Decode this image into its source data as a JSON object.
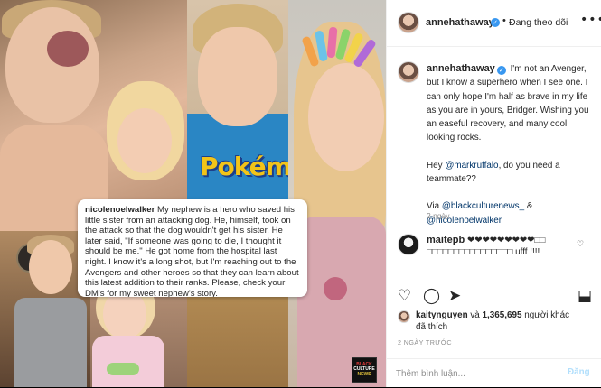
{
  "image": {
    "text_overlay": "Pokémon",
    "logo_text": [
      "BLACK",
      "CULTURE",
      "NEWS"
    ],
    "repost_caption": {
      "username": "nicolenoelwalker",
      "text": "My nephew is a hero who saved his little sister from an attacking dog.  He, himself, took on the attack so that the dog wouldn't get his sister.  He later said, \"If someone was going to die, I thought it should be me.\" He got home from the hospital last night.  I know it's a long shot, but I'm reaching out to the Avengers and other heroes so that they can learn about this latest addition to their ranks.  Please, check your DM's for my sweet nephew's story."
    }
  },
  "header": {
    "username": "annehathaway",
    "verified_mark": "✓",
    "separator": "•",
    "follow_label": "Đang theo dõi",
    "more_icon": "•••"
  },
  "caption": {
    "username": "annehathaway",
    "text": "I'm not an Avenger, but I know a superhero when I see one. I can only hope I'm half as brave in my life as you are in yours, Bridger. Wishing you an easeful recovery, and many cool looking rocks.",
    "line2_prefix": "Hey ",
    "line2_mention": "@markruffalo",
    "line2_suffix": ", do you need a teammate??",
    "line3_prefix": "Via ",
    "line3_mention1": "@blackculturenews_",
    "line3_mid": " & ",
    "line3_mention2": "@nicolenoelwalker",
    "time": "2 ngày"
  },
  "comment": {
    "username": "maitepb",
    "text": "❤❤❤❤❤❤❤❤❤□□ □□□□□□□□□□□□□□□□ ufff !!!!"
  },
  "actions": {
    "like_icon": "♡",
    "comment_icon": "◯",
    "share_icon": "➤",
    "save_icon": "⬓"
  },
  "likes": {
    "liker": "kaitynguyen",
    "middle": " và ",
    "count": "1,365,695",
    "suffix": " người khác",
    "line2": "đã thích"
  },
  "date": "2 NGÀY TRƯỚC",
  "comment_box": {
    "placeholder": "Thêm bình luận...",
    "post_label": "Đăng"
  },
  "colors": {
    "verified": "#3897f0",
    "mention": "#003569",
    "post_disabled": "#b2dffc",
    "secondary_text": "#8e8e8e"
  }
}
